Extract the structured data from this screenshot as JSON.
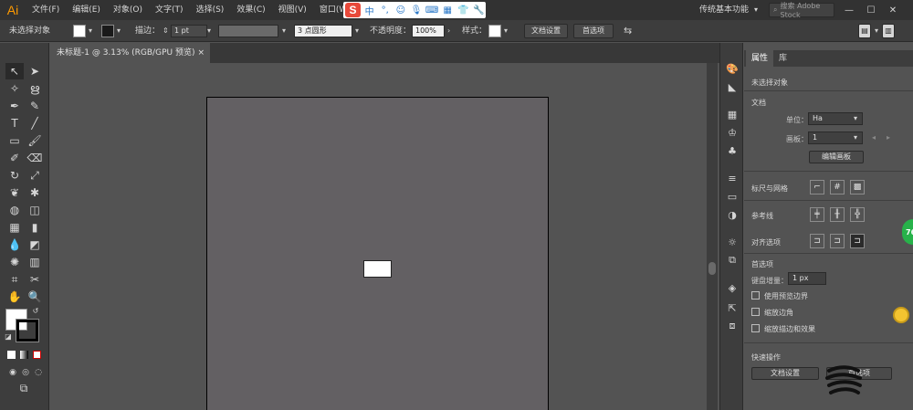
{
  "app": {
    "logo": "Ai"
  },
  "menu": [
    "文件(F)",
    "编辑(E)",
    "对象(O)",
    "文字(T)",
    "选择(S)",
    "效果(C)",
    "视图(V)",
    "窗口(W)",
    "帮"
  ],
  "ime": {
    "logo": "S",
    "label": "中"
  },
  "workspace": {
    "label": "传统基本功能"
  },
  "search": {
    "placeholder": "搜索 Adobe Stock"
  },
  "control": {
    "no_selection": "未选择对象",
    "stroke_label": "描边：",
    "stroke_value": "1 pt",
    "brush_value": "3 点圆形",
    "opacity_label": "不透明度：",
    "opacity_value": "100%",
    "style_label": "样式：",
    "doc_setup_button": "文档设置",
    "prefs_button": "首选项"
  },
  "document_tab": {
    "title": "未标题-1 @ 3.13% (RGB/GPU 预览)",
    "close": "×"
  },
  "panel": {
    "tab_properties": "属性",
    "tab_library": "库",
    "no_selection": "未选择对象",
    "document_section": "文档",
    "unit_label": "单位：",
    "unit_value": "Ha",
    "artboard_label": "画板：",
    "artboard_value": "1",
    "edit_artboard_button": "编辑画板",
    "rulers_grids": "标尺与网格",
    "guides": "参考线",
    "align_options": "对齐选项",
    "preferences_section": "首选项",
    "keyboard_increment_label": "键盘增量：",
    "keyboard_increment_value": "1 px",
    "use_preview_bounds": "使用预览边界",
    "scale_corners": "缩放边角",
    "scale_strokes_effects": "缩放描边和效果",
    "quick_actions": "快速操作",
    "quick_doc_setup": "文档设置",
    "quick_prefs": "首选项"
  },
  "badge": {
    "value": "76"
  },
  "colors": {
    "accent": "#ff9a00",
    "canvas": "#535353",
    "artboard": "#636063",
    "panel_dark": "#3d3d3d"
  }
}
